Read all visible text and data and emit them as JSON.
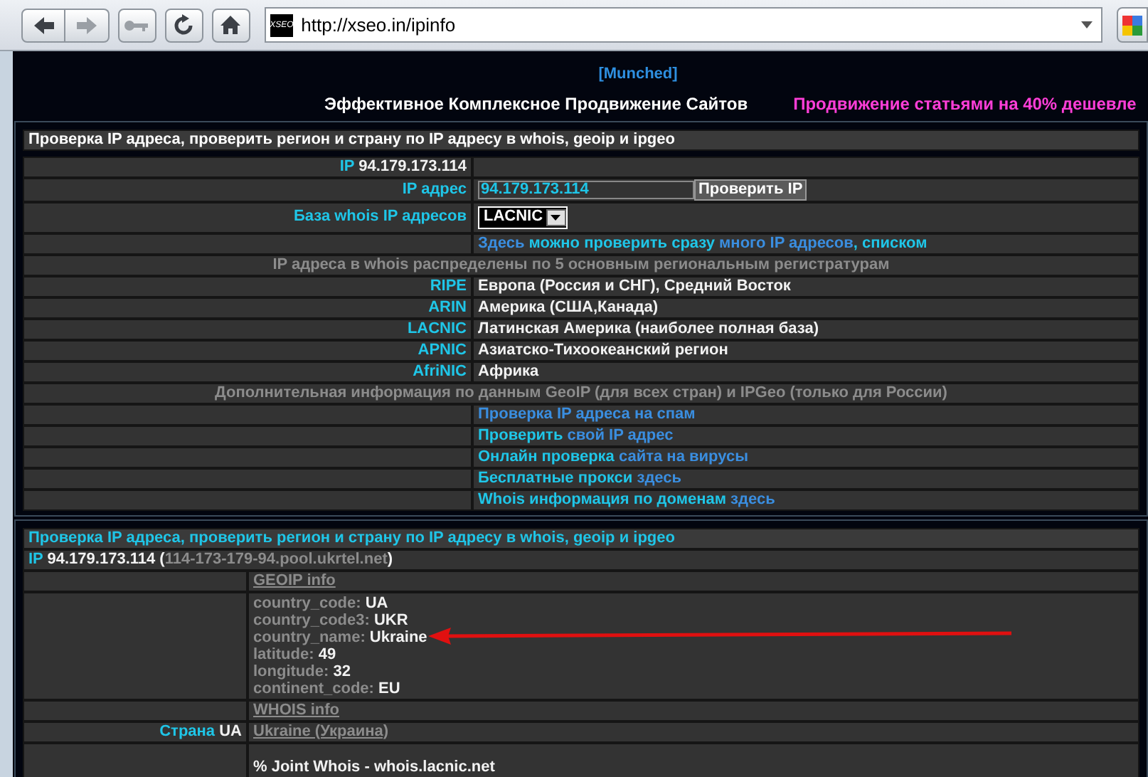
{
  "browser": {
    "url": "http://xseo.in/ipinfo",
    "site_icon_text": "XSEO"
  },
  "header": {
    "munched": "[Munched]",
    "title": "Эффективное Комплексное Продвижение Сайтов",
    "promo": "Продвижение статьями на 40% дешевле"
  },
  "ip_panel": {
    "title": "Проверка IP адреса, проверить регион и страну по IP адресу в whois, geoip и ipgeo",
    "rows": [
      {
        "kind": "pair",
        "label": [
          {
            "text": "IP ",
            "kind": "label"
          },
          {
            "text": "94.179.173.114",
            "kind": "text"
          }
        ],
        "value": []
      },
      {
        "kind": "input",
        "label": "IP адрес",
        "value": "94.179.173.114",
        "button": "Проверить IP"
      },
      {
        "kind": "select",
        "label": "База whois IP адресов",
        "value": "LACNIC"
      },
      {
        "kind": "pair",
        "label": [],
        "value": [
          {
            "text": "Здесь",
            "kind": "link"
          },
          {
            "text": " можно проверить сразу ",
            "kind": "label"
          },
          {
            "text": "много IP адресов",
            "kind": "link"
          },
          {
            "text": ", списком",
            "kind": "label"
          }
        ]
      },
      {
        "kind": "heading",
        "text": "IP адреса в whois распределены по 5 основным региональным регистратурам"
      },
      {
        "kind": "pair",
        "label": [
          {
            "text": "RIPE",
            "kind": "label"
          }
        ],
        "value": [
          {
            "text": "Европа (Россия и СНГ), Средний Восток",
            "kind": "text"
          }
        ]
      },
      {
        "kind": "pair",
        "label": [
          {
            "text": "ARIN",
            "kind": "label"
          }
        ],
        "value": [
          {
            "text": "Америка (США,Канада)",
            "kind": "text"
          }
        ]
      },
      {
        "kind": "pair",
        "label": [
          {
            "text": "LACNIC",
            "kind": "label"
          }
        ],
        "value": [
          {
            "text": "Латинская Америка (наиболее полная база)",
            "kind": "text"
          }
        ]
      },
      {
        "kind": "pair",
        "label": [
          {
            "text": "APNIC",
            "kind": "label"
          }
        ],
        "value": [
          {
            "text": "Азиатско-Тихоокеанский регион",
            "kind": "text"
          }
        ]
      },
      {
        "kind": "pair",
        "label": [
          {
            "text": "AfriNIC",
            "kind": "label"
          }
        ],
        "value": [
          {
            "text": "Африка",
            "kind": "text"
          }
        ]
      },
      {
        "kind": "heading",
        "text": "Дополнительная информация по данным GeoIP (для всех стран) и IPGeo (только для России)"
      },
      {
        "kind": "pair",
        "label": [],
        "value": [
          {
            "text": "Проверка IP адреса на спам",
            "kind": "link"
          }
        ]
      },
      {
        "kind": "pair",
        "label": [],
        "value": [
          {
            "text": "Проверить",
            "kind": "label"
          },
          {
            "text": " свой IP адрес",
            "kind": "link"
          }
        ]
      },
      {
        "kind": "pair",
        "label": [],
        "value": [
          {
            "text": "Онлайн проверка",
            "kind": "label"
          },
          {
            "text": " сайта на вирусы",
            "kind": "link"
          }
        ]
      },
      {
        "kind": "pair",
        "label": [],
        "value": [
          {
            "text": "Бесплатные прокси",
            "kind": "label"
          },
          {
            "text": " здесь",
            "kind": "link"
          }
        ]
      },
      {
        "kind": "pair",
        "label": [],
        "value": [
          {
            "text": "Whois информация по доменам",
            "kind": "label"
          },
          {
            "text": " здесь",
            "kind": "link"
          }
        ]
      }
    ]
  },
  "result_panel": {
    "title": "Проверка IP адреса, проверить регион и страну по IP адресу в whois, geoip и ipgeo",
    "ip_line": [
      {
        "text": "IP ",
        "kind": "label"
      },
      {
        "text": "94.179.173.114 (",
        "kind": "text"
      },
      {
        "text": "114-173-179-94.pool.ukrtel.net",
        "kind": "host"
      },
      {
        "text": ")",
        "kind": "text"
      }
    ],
    "rows": [
      {
        "kind": "pair",
        "label": [],
        "value": [
          {
            "text": "GEOIP info",
            "kind": "anchor"
          }
        ]
      },
      {
        "kind": "fields",
        "fields": [
          {
            "key": "country_code:",
            "value": "UA"
          },
          {
            "key": "country_code3:",
            "value": "UKR"
          },
          {
            "key": "country_name:",
            "value": "Ukraine"
          },
          {
            "key": "latitude:",
            "value": "49"
          },
          {
            "key": "longitude:",
            "value": "32"
          },
          {
            "key": "continent_code:",
            "value": "EU"
          }
        ]
      },
      {
        "kind": "pair",
        "label": [],
        "value": [
          {
            "text": "WHOIS info",
            "kind": "anchor"
          }
        ]
      },
      {
        "kind": "pair",
        "label": [
          {
            "text": "Страна ",
            "kind": "label"
          },
          {
            "text": "UA",
            "kind": "text"
          }
        ],
        "value": [
          {
            "text": "Ukraine (Украина)",
            "kind": "anchor"
          }
        ]
      },
      {
        "kind": "whois",
        "text": "% Joint Whois - whois.lacnic.net"
      }
    ]
  }
}
